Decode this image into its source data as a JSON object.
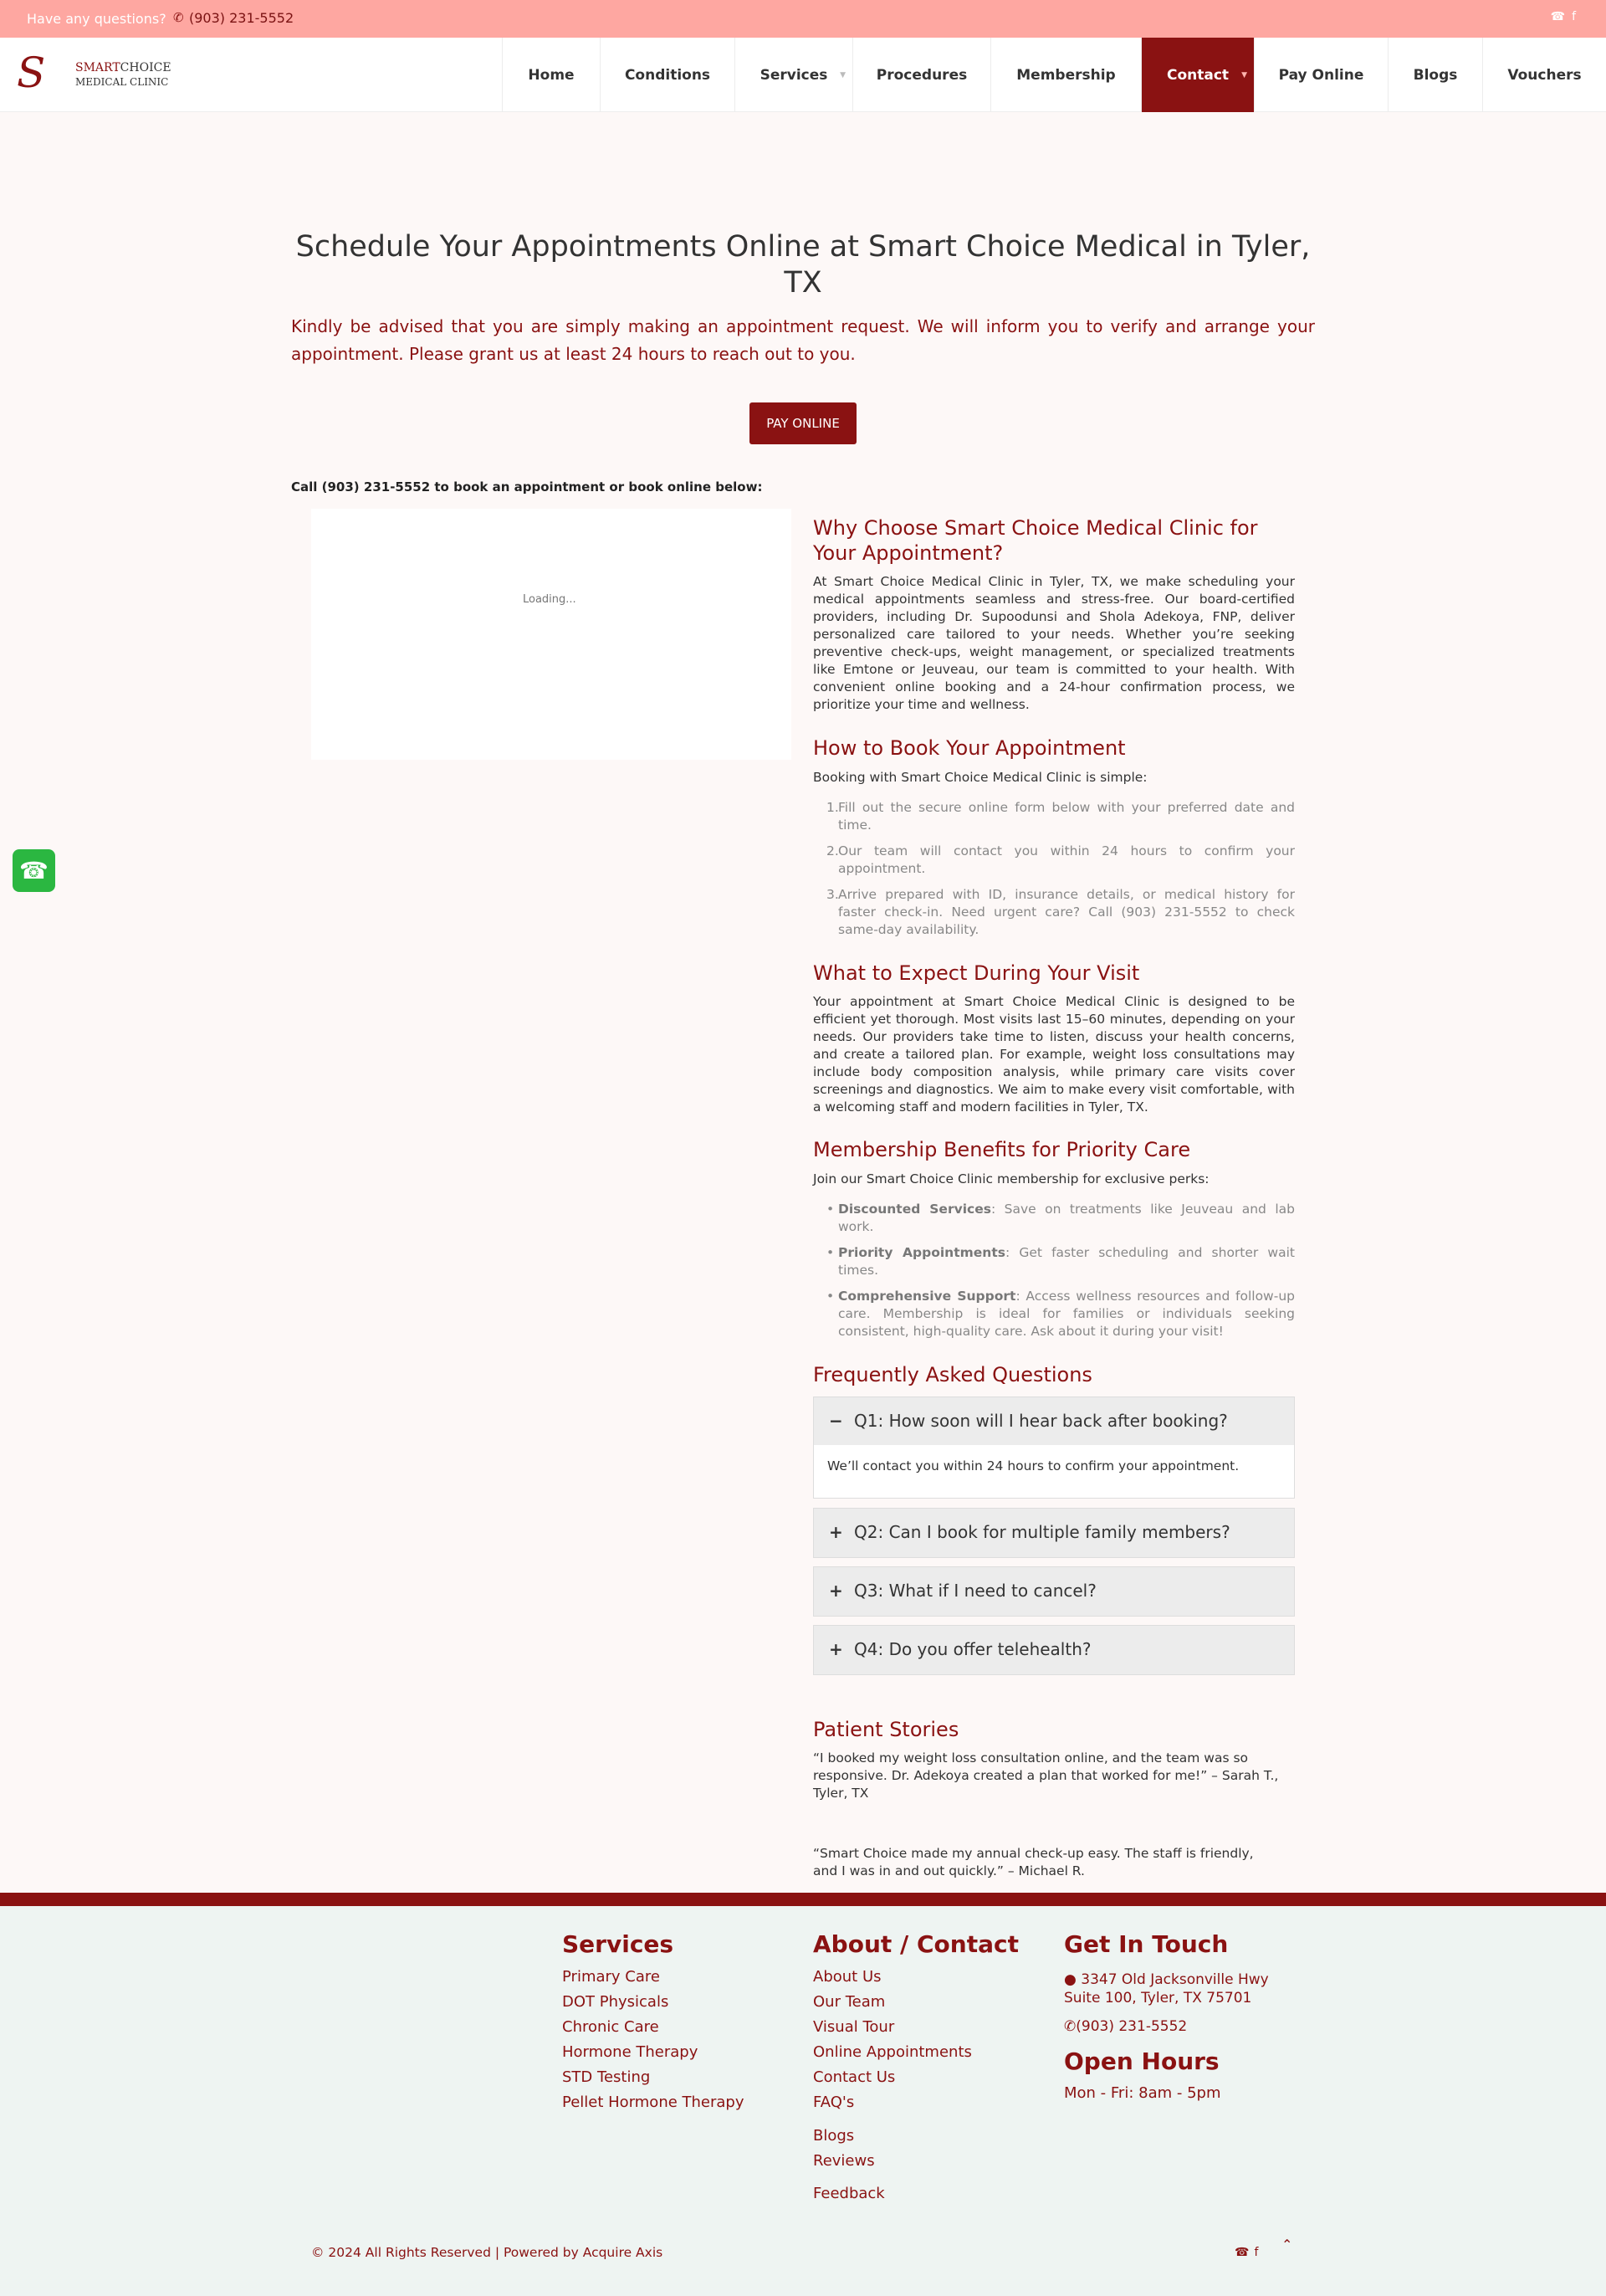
{
  "topbar": {
    "question": "Have any questions?",
    "phone_icon": "phone-icon",
    "phone": "(903) 231-5552",
    "social_icons": [
      "whatsapp-icon",
      "facebook-icon"
    ]
  },
  "header": {
    "logo_mark": "S",
    "logo_line1_a": "SMART",
    "logo_line1_b": "CHOICE",
    "logo_line2": "MEDICAL CLINIC",
    "nav": [
      {
        "label": "Home"
      },
      {
        "label": "Conditions"
      },
      {
        "label": "Services"
      },
      {
        "label": "Procedures"
      },
      {
        "label": "Membership"
      },
      {
        "label": "Contact"
      },
      {
        "label": "Pay Online"
      },
      {
        "label": "Blogs"
      },
      {
        "label": "Vouchers"
      }
    ],
    "active": "Contact"
  },
  "main": {
    "title": "Schedule Your Appointments Online at Smart Choice Medical in Tyler, TX",
    "intro": "Kindly be advised that you are simply making an appointment request. We will inform you to verify and arrange your appointment. Please grant us at least 24 hours to reach out to you.",
    "pay_button": "PAY ONLINE",
    "call_line": "Call (903) 231-5552 to book an appointment or book online below:",
    "loading": "Loading...",
    "why_heading": "Why Choose Smart Choice Medical Clinic for Your Appointment?",
    "why_text": "At Smart Choice Medical Clinic in Tyler, TX, we make scheduling your medical appointments seamless and stress-free. Our board-certified providers, including Dr. Supoodunsi and Shola Adekoya, FNP, deliver personalized care tailored to your needs. Whether you’re seeking preventive check-ups, weight management, or specialized treatments like Emtone or Jeuveau, our team is committed to your health. With convenient online booking and a 24-hour confirmation process, we prioritize your time and wellness.",
    "how_heading": "How to Book Your Appointment",
    "how_intro": "Booking with Smart Choice Medical Clinic is simple:",
    "how_steps": [
      "Fill out the secure online form below with your preferred date and time.",
      "Our team will contact you within 24 hours to confirm your appointment.",
      "Arrive prepared with ID, insurance details, or medical history for faster check-in. Need urgent care? Call (903) 231-5552 to check same-day availability."
    ],
    "expect_heading": "What to Expect During Your Visit",
    "expect_text": "Your appointment at Smart Choice Medical Clinic is designed to be efficient yet thorough. Most visits last 15–60 minutes, depending on your needs. Our providers take time to listen, discuss your health concerns, and create a tailored plan. For example, weight loss consultations may include body composition analysis, while primary care visits cover screenings and diagnostics. We aim to make every visit comfortable, with a welcoming staff and modern facilities in Tyler, TX.",
    "member_heading": "Membership Benefits for Priority Care",
    "member_intro": "Join our Smart Choice Clinic membership for exclusive perks:",
    "member_perks": [
      {
        "title": "Discounted Services",
        "text": ": Save on treatments like Jeuveau and lab work."
      },
      {
        "title": "Priority Appointments",
        "text": ": Get faster scheduling and shorter wait times."
      },
      {
        "title": "Comprehensive Support",
        "text": ": Access wellness resources and follow-up care. Membership is ideal for families or individuals seeking consistent, high-quality care. Ask about it during your visit!"
      }
    ],
    "faq_heading": "Frequently Asked Questions",
    "faqs": [
      {
        "sign": "−",
        "q": "Q1: How soon will I hear back after booking?",
        "a": "We’ll contact you within 24 hours to confirm your appointment."
      },
      {
        "sign": "+",
        "q": "Q2: Can I book for multiple family members?"
      },
      {
        "sign": "+",
        "q": "Q3: What if I need to cancel?"
      },
      {
        "sign": "+",
        "q": "Q4: Do you offer telehealth?"
      }
    ],
    "stories_heading": "Patient Stories",
    "stories": [
      "“I booked my weight loss consultation online, and the team was so responsive. Dr. Adekoya created a plan that worked for me!” – Sarah T., Tyler, TX",
      "“Smart Choice made my annual check-up easy. The staff is friendly, and I was in and out quickly.” – Michael R."
    ]
  },
  "footer": {
    "services_heading": "Services",
    "services": [
      "Primary Care",
      "DOT Physicals",
      "Chronic Care",
      "Hormone Therapy",
      "STD Testing",
      "Pellet Hormone Therapy"
    ],
    "about_heading": "About / Contact",
    "about": [
      "About Us",
      "Our Team",
      "Visual Tour",
      "Online Appointments",
      "Contact Us",
      "FAQ's",
      "Blogs",
      "Reviews",
      "Feedback"
    ],
    "touch_heading": "Get In Touch",
    "address1": "3347 Old Jacksonville Hwy",
    "address2": "Suite 100, Tyler, TX 75701",
    "phone": "(903) 231-5552",
    "hours_heading": "Open Hours",
    "hours": "Mon - Fri: 8am - 5pm",
    "copyright": "© 2024 All Rights Reserved | Powered by Acquire Axis"
  },
  "colors": {
    "brand": "#8a1212",
    "topbar": "#fea7a1",
    "whatsapp": "#2bb741"
  }
}
